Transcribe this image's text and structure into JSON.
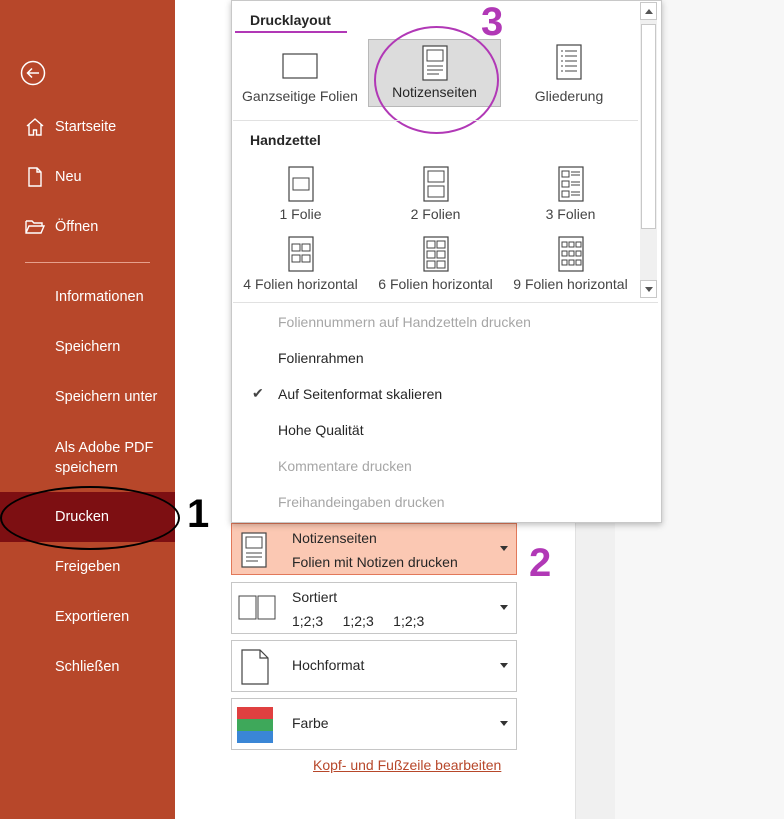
{
  "sidebar": {
    "items": [
      {
        "label": "Startseite",
        "icon": "home-icon"
      },
      {
        "label": "Neu",
        "icon": "new-document-icon"
      },
      {
        "label": "Öffnen",
        "icon": "folder-open-icon"
      },
      {
        "label": "Informationen"
      },
      {
        "label": "Speichern"
      },
      {
        "label": "Speichern unter"
      },
      {
        "label": "Als Adobe PDF\nspeichern"
      },
      {
        "label": "Drucken",
        "active": true
      },
      {
        "label": "Freigeben"
      },
      {
        "label": "Exportieren"
      },
      {
        "label": "Schließen"
      }
    ],
    "back_icon": "back-arrow-icon",
    "bg_color": "#b7472a",
    "active_color": "#7d0f12"
  },
  "annotations": {
    "n1": "1",
    "n2": "2",
    "n3": "3",
    "marker_color": "#b138b6"
  },
  "dropdown": {
    "layout_heading": "Drucklayout",
    "layouts": [
      {
        "label": "Ganzseitige Folien",
        "icon": "full-page-slide-icon"
      },
      {
        "label": "Notizenseiten",
        "icon": "notes-page-icon",
        "selected": true
      },
      {
        "label": "Gliederung",
        "icon": "outline-icon"
      }
    ],
    "handouts_heading": "Handzettel",
    "handouts": [
      {
        "label": "1 Folie",
        "icon": "handout-1-icon"
      },
      {
        "label": "2 Folien",
        "icon": "handout-2-icon"
      },
      {
        "label": "3 Folien",
        "icon": "handout-3-icon"
      },
      {
        "label": "4 Folien horizontal",
        "icon": "handout-4-icon"
      },
      {
        "label": "6 Folien horizontal",
        "icon": "handout-6-icon"
      },
      {
        "label": "9 Folien horizontal",
        "icon": "handout-9-icon"
      }
    ],
    "options": [
      {
        "label": "Foliennummern auf Handzetteln drucken",
        "disabled": true
      },
      {
        "label": "Folienrahmen",
        "disabled": false
      },
      {
        "label": "Auf Seitenformat skalieren",
        "disabled": false,
        "checked": true
      },
      {
        "label": "Hohe Qualität",
        "disabled": false
      },
      {
        "label": "Kommentare drucken",
        "disabled": true
      },
      {
        "label": "Freihandeingaben drucken",
        "disabled": true
      }
    ]
  },
  "settings": [
    {
      "title": "Notizenseiten",
      "subtitle": "Folien mit Notizen drucken",
      "icon": "notes-page-icon",
      "selected": true
    },
    {
      "title": "Sortiert",
      "subtitle": "1;2;3     1;2;3     1;2;3",
      "icon": "collate-icon"
    },
    {
      "title": "Hochformat",
      "subtitle": "",
      "icon": "portrait-page-icon"
    },
    {
      "title": "Farbe",
      "subtitle": "",
      "icon": "color-icon"
    }
  ],
  "link": "Kopf- und Fußzeile bearbeiten"
}
